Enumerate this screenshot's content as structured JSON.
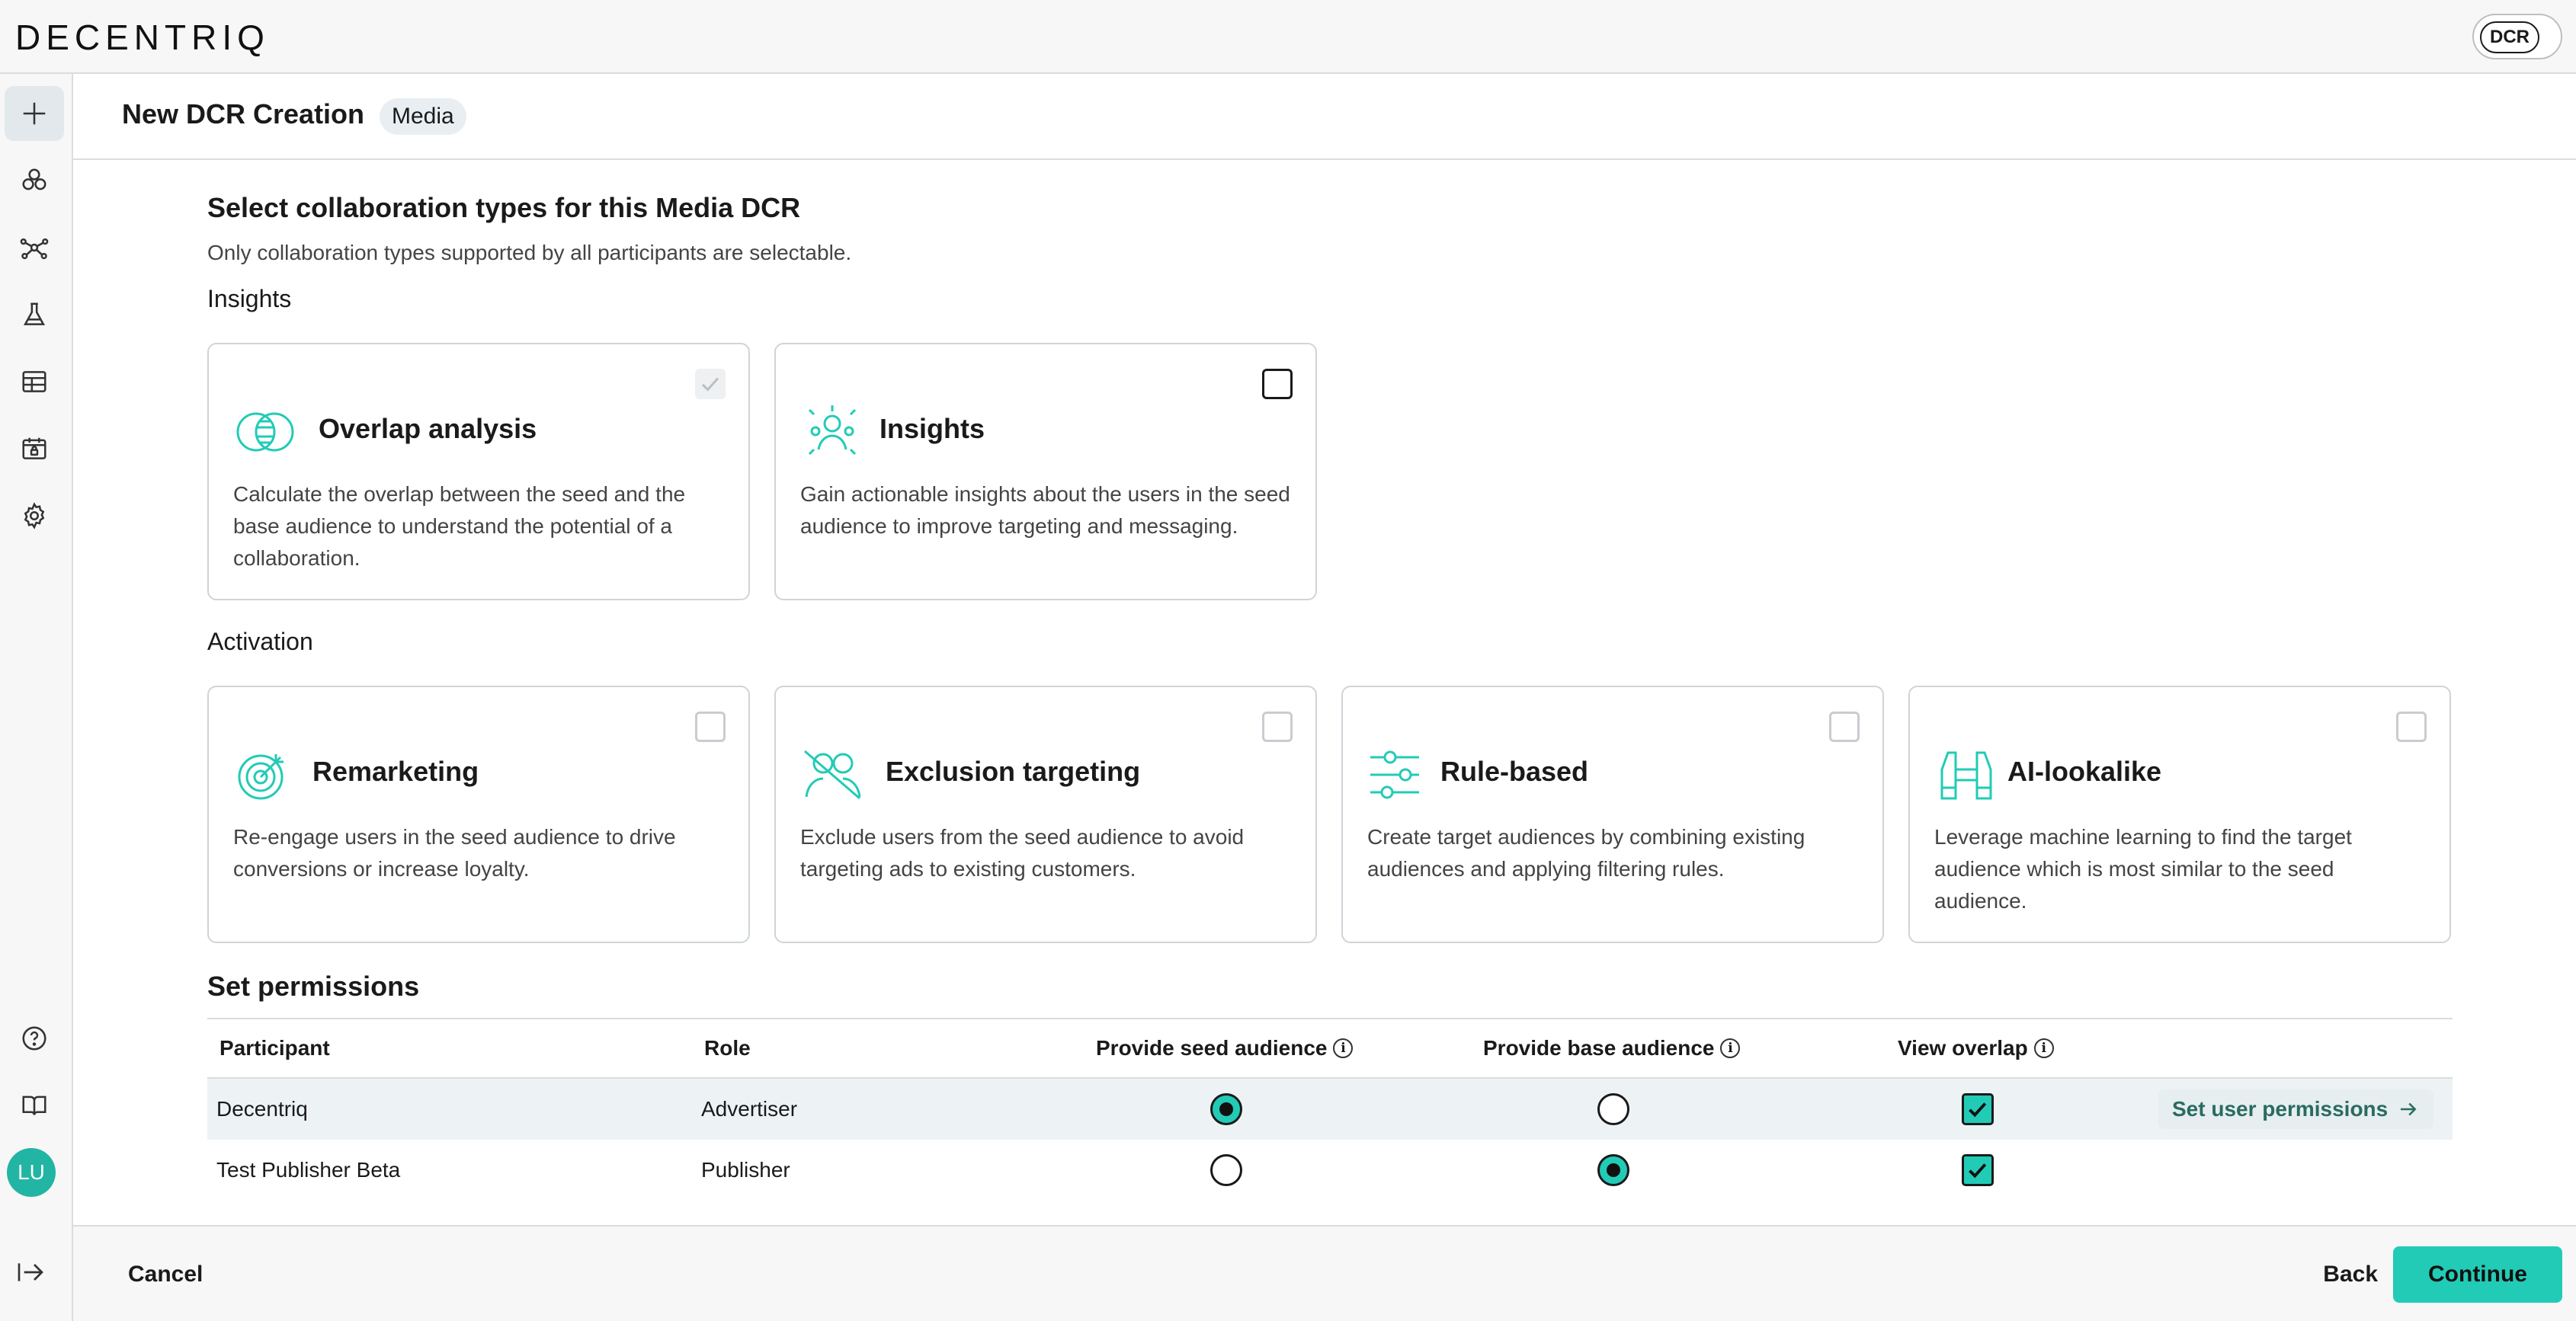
{
  "app": {
    "logo": "DECENTRIQ",
    "badge": "DCR"
  },
  "sidebar": {
    "icons": [
      "plus-icon",
      "cubes-icon",
      "network-icon",
      "flask-icon",
      "table-icon",
      "calendar-lock-icon",
      "gear-icon",
      "help-icon",
      "book-icon"
    ],
    "avatar_initials": "LU",
    "logout_icon": "logout-icon"
  },
  "header": {
    "title": "New DCR Creation",
    "chip": "Media"
  },
  "collab": {
    "heading": "Select collaboration types for this Media DCR",
    "subtitle": "Only collaboration types supported by all participants are selectable.",
    "insights_label": "Insights",
    "activation_label": "Activation",
    "insights_cards": [
      {
        "title": "Overlap analysis",
        "desc": "Calculate the overlap between the seed and the base audience to understand the potential of a collaboration.",
        "icon": "overlap-icon",
        "state": "checked-disabled"
      },
      {
        "title": "Insights",
        "desc": "Gain actionable insights about the users in the seed audience to improve targeting and messaging.",
        "icon": "users-insights-icon",
        "state": "unchecked"
      }
    ],
    "activation_cards": [
      {
        "title": "Remarketing",
        "desc": "Re-engage users in the seed audience to drive conversions or increase loyalty.",
        "icon": "target-icon",
        "state": "disabled"
      },
      {
        "title": "Exclusion targeting",
        "desc": "Exclude users from the seed audience to avoid targeting ads to existing customers.",
        "icon": "exclude-users-icon",
        "state": "disabled"
      },
      {
        "title": "Rule-based",
        "desc": "Create target audiences by combining existing audiences and applying filtering rules.",
        "icon": "sliders-icon",
        "state": "disabled"
      },
      {
        "title": "AI-lookalike",
        "desc": "Leverage machine learning to find the target audience which is most similar to the seed audience.",
        "icon": "binoculars-icon",
        "state": "disabled"
      }
    ]
  },
  "permissions": {
    "heading": "Set permissions",
    "columns": [
      "Participant",
      "Role",
      "Provide seed audience",
      "Provide base audience",
      "View overlap"
    ],
    "rows": [
      {
        "participant": "Decentriq",
        "role": "Advertiser",
        "seed": true,
        "base": false,
        "overlap": true,
        "link": "Set user permissions"
      },
      {
        "participant": "Test Publisher Beta",
        "role": "Publisher",
        "seed": false,
        "base": true,
        "overlap": true
      }
    ]
  },
  "footer": {
    "cancel": "Cancel",
    "back": "Back",
    "continue": "Continue"
  },
  "colors": {
    "accent": "#22cbb6",
    "avatar": "#22b5a3",
    "link": "#2a6b60"
  }
}
